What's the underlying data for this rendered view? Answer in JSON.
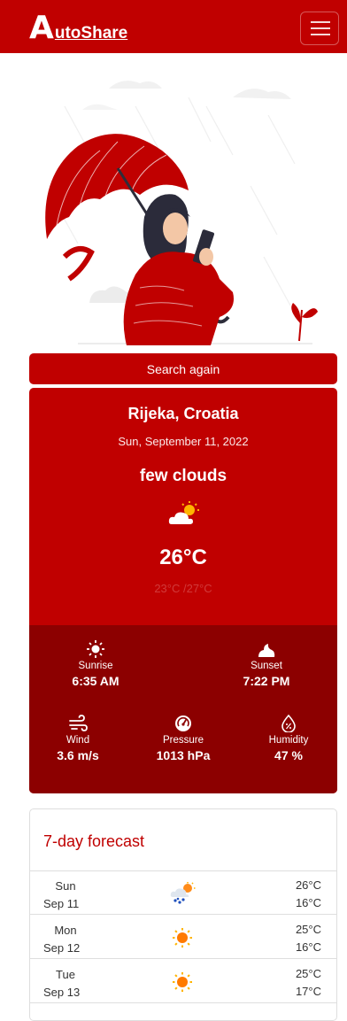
{
  "navbar": {
    "brand_initial": "A",
    "brand_rest": "utoShare"
  },
  "hero": {
    "illustration": "woman-with-red-umbrella-illustration"
  },
  "search_again_label": "Search again",
  "weather": {
    "location": "Rijeka, Croatia",
    "date": "Sun, September 11, 2022",
    "description": "few clouds",
    "condition_icon": "sun-behind-cloud-icon",
    "temperature": "26°C",
    "min_max": "23°C /27°C",
    "sunrise": {
      "label": "Sunrise",
      "value": "6:35 AM",
      "icon": "sun-icon"
    },
    "sunset": {
      "label": "Sunset",
      "value": "7:22 PM",
      "icon": "sunset-icon"
    },
    "wind": {
      "label": "Wind",
      "value": "3.6 m/s",
      "icon": "wind-icon"
    },
    "pressure": {
      "label": "Pressure",
      "value": "1013 hPa",
      "icon": "gauge-icon"
    },
    "humidity": {
      "label": "Humidity",
      "value": "47 %",
      "icon": "humidity-drop-icon"
    }
  },
  "forecast": {
    "title": "7-day forecast",
    "days": [
      {
        "day": "Sun",
        "date": "Sep 11",
        "icon": "sun-cloud-rain-icon",
        "max": "26°C",
        "min": "16°C"
      },
      {
        "day": "Mon",
        "date": "Sep 12",
        "icon": "sun-icon",
        "max": "25°C",
        "min": "16°C"
      },
      {
        "day": "Tue",
        "date": "Sep 13",
        "icon": "sun-icon",
        "max": "25°C",
        "min": "17°C"
      }
    ]
  },
  "colors": {
    "primary": "#c00000",
    "dark": "#8c0000",
    "minmax_text": "#d13a3a"
  }
}
